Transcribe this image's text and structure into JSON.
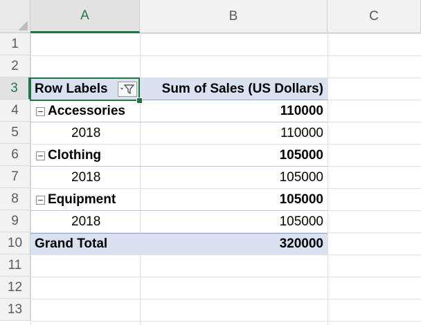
{
  "columns": [
    "A",
    "B",
    "C"
  ],
  "rows": [
    "1",
    "2",
    "3",
    "4",
    "5",
    "6",
    "7",
    "8",
    "9",
    "10",
    "11",
    "12",
    "13"
  ],
  "pivot": {
    "header": {
      "row_labels": "Row Labels",
      "value_label": "Sum of Sales (US Dollars)"
    },
    "groups": [
      {
        "label": "Accessories",
        "total": "110000",
        "year": "2018",
        "year_value": "110000"
      },
      {
        "label": "Clothing",
        "total": "105000",
        "year": "2018",
        "year_value": "105000"
      },
      {
        "label": "Equipment",
        "total": "105000",
        "year": "2018",
        "year_value": "105000"
      }
    ],
    "grand_total": {
      "label": "Grand Total",
      "value": "320000"
    }
  },
  "colors": {
    "accent": "#217346",
    "pivot_band": "#dae1f1",
    "pivot_line": "#8ea6d3"
  },
  "icons": {
    "filter": "filter-dropdown-icon",
    "collapse": "collapse-minus-icon"
  }
}
